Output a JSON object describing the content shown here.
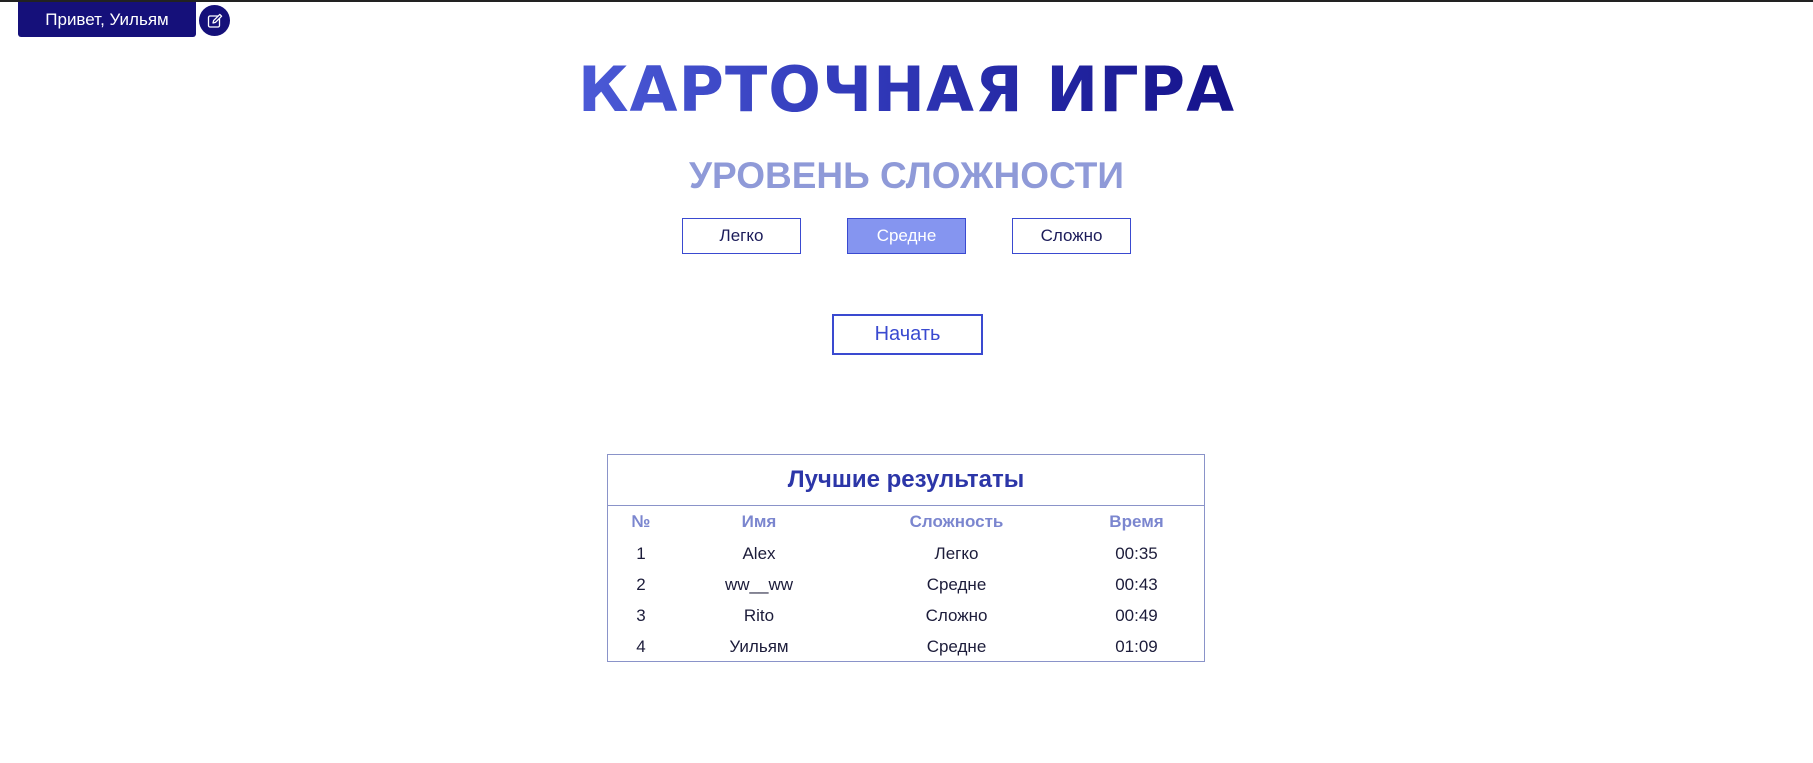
{
  "header": {
    "greeting": "Привет, Уильям",
    "edit_icon": "edit-icon"
  },
  "main": {
    "title": "КАРТОЧНАЯ ИГРА",
    "subtitle": "УРОВЕНЬ СЛОЖНОСТИ",
    "levels": [
      {
        "label": "Легко",
        "selected": false
      },
      {
        "label": "Средне",
        "selected": true
      },
      {
        "label": "Сложно",
        "selected": false
      }
    ],
    "start_label": "Начать"
  },
  "leaderboard": {
    "title": "Лучшие результаты",
    "columns": [
      "№",
      "Имя",
      "Сложность",
      "Время"
    ],
    "rows": [
      [
        "1",
        "Alex",
        "Легко",
        "00:35"
      ],
      [
        "2",
        "ww__ww",
        "Средне",
        "00:43"
      ],
      [
        "3",
        "Rito",
        "Сложно",
        "00:49"
      ],
      [
        "4",
        "Уильям",
        "Средне",
        "01:09"
      ]
    ]
  },
  "colors": {
    "accent": "#3a4ad0",
    "header_bg": "#15107a",
    "selected_level": "#8595f0",
    "subtitle": "#8f9ad8"
  }
}
